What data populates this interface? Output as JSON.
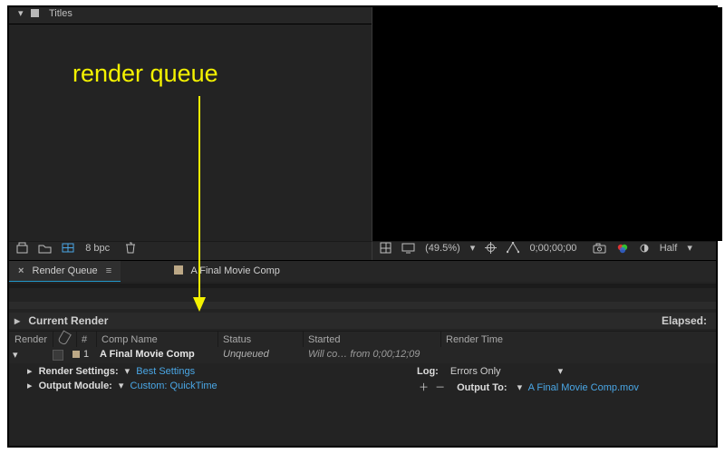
{
  "project": {
    "titles_label": "Titles"
  },
  "footer_left": {
    "bpc_label": "8 bpc"
  },
  "footer_right": {
    "zoom": "(49.5%)",
    "timecode": "0;00;00;00",
    "quality": "Half"
  },
  "tabs": {
    "render_queue": "Render Queue",
    "comp": "A Final Movie Comp"
  },
  "queue": {
    "current_render_label": "Current Render",
    "elapsed_label": "Elapsed:",
    "columns": {
      "render": "Render",
      "num": "#",
      "comp_name": "Comp Name",
      "status": "Status",
      "started": "Started",
      "render_time": "Render Time"
    },
    "item": {
      "num": "1",
      "name": "A Final Movie Comp",
      "status": "Unqueued",
      "started": "Will co… from 0;00;12;09"
    },
    "render_settings": {
      "label": "Render Settings:",
      "value": "Best Settings"
    },
    "output_module": {
      "label": "Output Module:",
      "value": "Custom: QuickTime"
    },
    "log": {
      "label": "Log:",
      "value": "Errors Only"
    },
    "output_to": {
      "label": "Output To:",
      "value": "A Final Movie Comp.mov"
    }
  },
  "annotation": {
    "text": "render queue"
  }
}
